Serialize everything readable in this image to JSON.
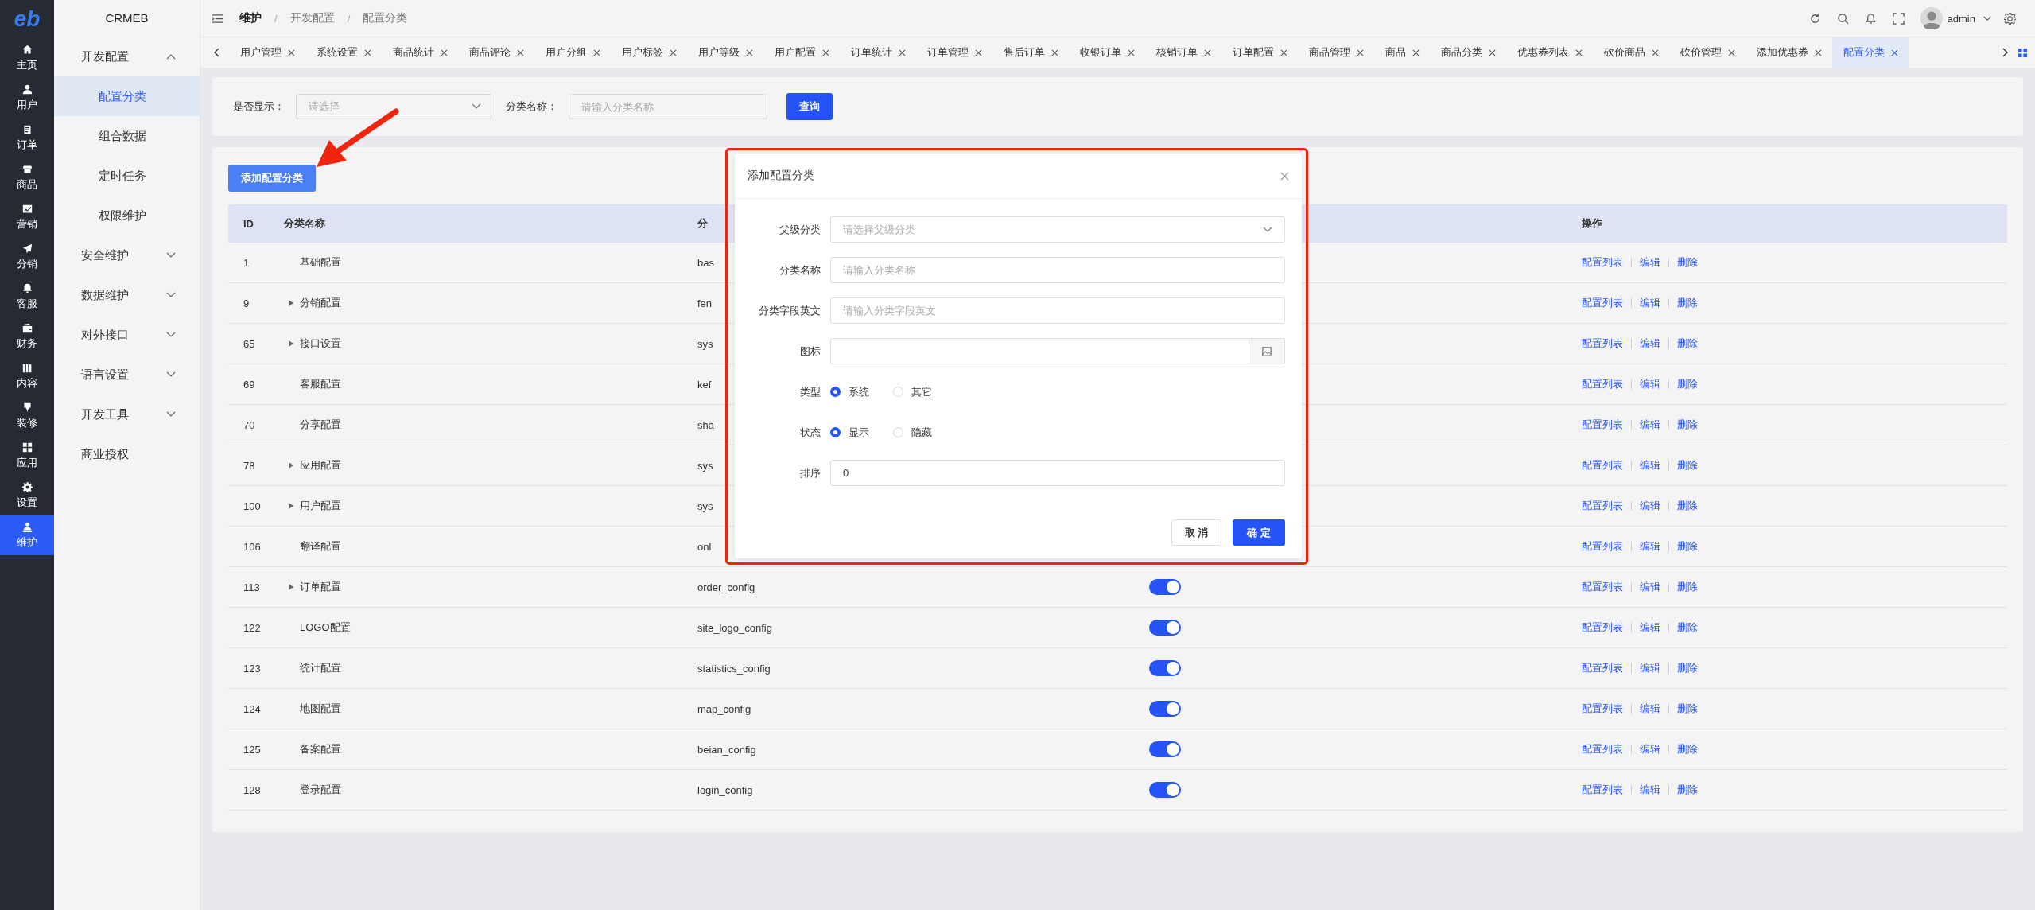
{
  "rail": {
    "logo": "eb",
    "items": [
      {
        "label": "主页",
        "selected": false
      },
      {
        "label": "用户",
        "selected": false
      },
      {
        "label": "订单",
        "selected": false
      },
      {
        "label": "商品",
        "selected": false
      },
      {
        "label": "营销",
        "selected": false
      },
      {
        "label": "分销",
        "selected": false
      },
      {
        "label": "客服",
        "selected": false
      },
      {
        "label": "财务",
        "selected": false
      },
      {
        "label": "内容",
        "selected": false
      },
      {
        "label": "装修",
        "selected": false
      },
      {
        "label": "应用",
        "selected": false
      },
      {
        "label": "设置",
        "selected": false
      },
      {
        "label": "维护",
        "selected": true
      }
    ]
  },
  "sidebar": {
    "title": "CRMEB",
    "items": [
      {
        "label": "开发配置",
        "kind": "group",
        "expanded": true,
        "children": [
          {
            "label": "配置分类",
            "selected": true
          },
          {
            "label": "组合数据",
            "selected": false
          },
          {
            "label": "定时任务",
            "selected": false
          },
          {
            "label": "权限维护",
            "selected": false
          }
        ]
      },
      {
        "label": "安全维护",
        "kind": "group",
        "expanded": false
      },
      {
        "label": "数据维护",
        "kind": "group",
        "expanded": false
      },
      {
        "label": "对外接口",
        "kind": "group",
        "expanded": false
      },
      {
        "label": "语言设置",
        "kind": "group",
        "expanded": false
      },
      {
        "label": "开发工具",
        "kind": "group",
        "expanded": false
      },
      {
        "label": "商业授权",
        "kind": "link"
      }
    ]
  },
  "header": {
    "breadcrumb": [
      {
        "label": "维护"
      },
      {
        "separator": "/",
        "label": "开发配置"
      },
      {
        "separator": "/",
        "label": "配置分类"
      }
    ],
    "user": "admin"
  },
  "tabs": [
    {
      "label": "用户管理",
      "selected": false
    },
    {
      "label": "系统设置",
      "selected": false
    },
    {
      "label": "商品统计",
      "selected": false
    },
    {
      "label": "商品评论",
      "selected": false
    },
    {
      "label": "用户分组",
      "selected": false
    },
    {
      "label": "用户标签",
      "selected": false
    },
    {
      "label": "用户等级",
      "selected": false
    },
    {
      "label": "用户配置",
      "selected": false
    },
    {
      "label": "订单统计",
      "selected": false
    },
    {
      "label": "订单管理",
      "selected": false
    },
    {
      "label": "售后订单",
      "selected": false
    },
    {
      "label": "收银订单",
      "selected": false
    },
    {
      "label": "核销订单",
      "selected": false
    },
    {
      "label": "订单配置",
      "selected": false
    },
    {
      "label": "商品管理",
      "selected": false
    },
    {
      "label": "商品",
      "selected": false
    },
    {
      "label": "商品分类",
      "selected": false
    },
    {
      "label": "优惠券列表",
      "selected": false
    },
    {
      "label": "砍价商品",
      "selected": false
    },
    {
      "label": "砍价管理",
      "selected": false
    },
    {
      "label": "添加优惠券",
      "selected": false
    },
    {
      "label": "配置分类",
      "selected": true
    }
  ],
  "filter": {
    "show_label": "是否显示：",
    "show_placeholder": "请选择",
    "name_label": "分类名称：",
    "name_placeholder": "请输入分类名称",
    "search_button": "查询"
  },
  "add_button": "添加配置分类",
  "table": {
    "columns": [
      "ID",
      "分类名称",
      "分",
      "操作"
    ],
    "rows": [
      {
        "id": "1",
        "name": "基础配置",
        "key": "bas",
        "actions": [
          "配置列表",
          "编辑",
          "删除"
        ]
      },
      {
        "id": "9",
        "name": "分销配置",
        "expanded": false,
        "key": "fen",
        "actions": [
          "配置列表",
          "编辑",
          "删除"
        ]
      },
      {
        "id": "65",
        "name": "接口设置",
        "expanded": false,
        "key": "sys",
        "actions": [
          "配置列表",
          "编辑",
          "删除"
        ]
      },
      {
        "id": "69",
        "name": "客服配置",
        "key": "kef",
        "actions": [
          "配置列表",
          "编辑",
          "删除"
        ]
      },
      {
        "id": "70",
        "name": "分享配置",
        "key": "sha",
        "actions": [
          "配置列表",
          "编辑",
          "删除"
        ]
      },
      {
        "id": "78",
        "name": "应用配置",
        "expanded": false,
        "key": "sys",
        "actions": [
          "配置列表",
          "编辑",
          "删除"
        ]
      },
      {
        "id": "100",
        "name": "用户配置",
        "expanded": false,
        "key": "sys",
        "actions": [
          "配置列表",
          "编辑",
          "删除"
        ]
      },
      {
        "id": "106",
        "name": "翻译配置",
        "key": "onl",
        "actions": [
          "配置列表",
          "编辑",
          "删除"
        ]
      },
      {
        "id": "113",
        "name": "订单配置",
        "expanded": false,
        "key": "order_config",
        "on": true,
        "actions": [
          "配置列表",
          "编辑",
          "删除"
        ]
      },
      {
        "id": "122",
        "name": "LOGO配置",
        "key": "site_logo_config",
        "on": true,
        "actions": [
          "配置列表",
          "编辑",
          "删除"
        ]
      },
      {
        "id": "123",
        "name": "统计配置",
        "key": "statistics_config",
        "on": true,
        "actions": [
          "配置列表",
          "编辑",
          "删除"
        ]
      },
      {
        "id": "124",
        "name": "地图配置",
        "key": "map_config",
        "on": true,
        "actions": [
          "配置列表",
          "编辑",
          "删除"
        ]
      },
      {
        "id": "125",
        "name": "备案配置",
        "key": "beian_config",
        "on": true,
        "actions": [
          "配置列表",
          "编辑",
          "删除"
        ]
      },
      {
        "id": "128",
        "name": "登录配置",
        "key": "login_config",
        "on": true,
        "actions": [
          "配置列表",
          "编辑",
          "删除"
        ]
      }
    ]
  },
  "dialog": {
    "title": "添加配置分类",
    "fields": [
      {
        "label": "父级分类",
        "kind": "select",
        "placeholder": "请选择父级分类"
      },
      {
        "label": "分类名称",
        "kind": "input",
        "placeholder": "请输入分类名称"
      },
      {
        "label": "分类字段英文",
        "kind": "input",
        "placeholder": "请输入分类字段英文"
      },
      {
        "label": "图标",
        "kind": "upload"
      },
      {
        "label": "类型",
        "kind": "radio",
        "options": [
          {
            "label": "系统",
            "selected": true
          },
          {
            "label": "其它",
            "selected": false
          }
        ]
      },
      {
        "label": "状态",
        "kind": "radio",
        "options": [
          {
            "label": "显示",
            "selected": true
          },
          {
            "label": "隐藏",
            "selected": false
          }
        ]
      },
      {
        "label": "排序",
        "kind": "input",
        "value": "0"
      }
    ],
    "buttons": [
      {
        "label": "取 消",
        "kind": "default"
      },
      {
        "label": "确 定",
        "kind": "primary"
      }
    ]
  }
}
